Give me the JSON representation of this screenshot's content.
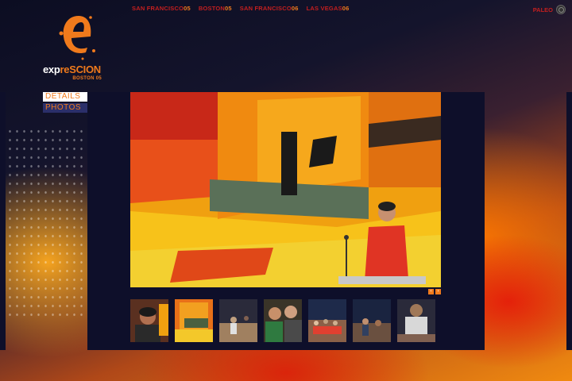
{
  "top_nav": [
    {
      "city": "SAN FRANCISCO",
      "year": "05"
    },
    {
      "city": "BOSTON",
      "year": "05"
    },
    {
      "city": "SAN FRANCISCO",
      "year": "06"
    },
    {
      "city": "LAS VEGAS",
      "year": "06"
    }
  ],
  "language": {
    "label": "PALEO",
    "icon": "globe-icon"
  },
  "logo": {
    "word_main": "exp",
    "word_accent": "re",
    "word_rest": "SCION",
    "sub": "BOSTON 05"
  },
  "side_menu": [
    {
      "label": "DETAILS",
      "active": true
    },
    {
      "label": "PHOTOS",
      "active": false
    }
  ],
  "gallery": {
    "prev_icon": "chevron-left-icon",
    "next_icon": "chevron-right-icon",
    "thumbnails": [
      "thumb-1",
      "thumb-2",
      "thumb-3",
      "thumb-4",
      "thumb-5",
      "thumb-6",
      "thumb-7"
    ]
  },
  "colors": {
    "accent": "#f07a1c",
    "nav_red": "#c41f1f",
    "panel": "#0e0f2a"
  }
}
